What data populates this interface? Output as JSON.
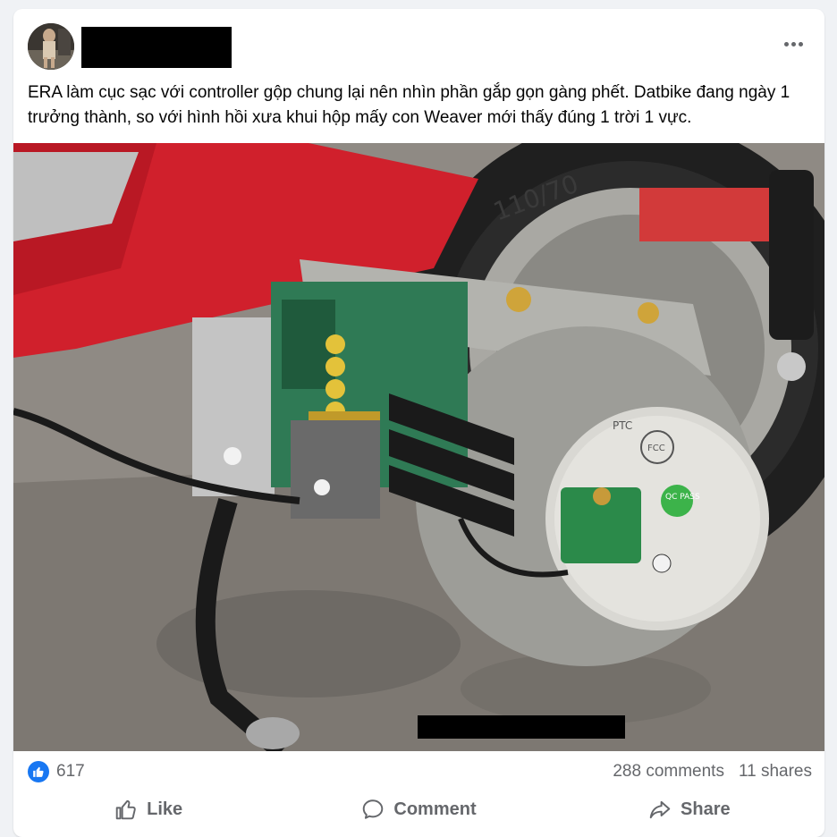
{
  "post": {
    "text": "ERA làm cục sạc với controller gộp chung lại nên nhìn phần gắp gọn gàng phết. Datbike đang ngày 1 trưởng thành, so với hình hồi xưa khui hộp mấy con Weaver mới thấy đúng 1 trời 1 vực.",
    "photo_labels": {
      "tire_marking": "110/70",
      "motor_badge_1": "FCC",
      "motor_badge_2": "QC PASS",
      "motor_brand": "PTC"
    }
  },
  "stats": {
    "reactions_count": "617",
    "comments": "288 comments",
    "shares": "11 shares"
  },
  "actions": {
    "like": "Like",
    "comment": "Comment",
    "share": "Share"
  },
  "icons": {
    "more": "more-horizontal-icon",
    "reaction": "thumbs-up-icon",
    "like": "thumbs-up-outline-icon",
    "comment": "comment-bubble-icon",
    "share": "share-arrow-icon"
  },
  "colors": {
    "accent": "#1877f2",
    "secondary_text": "#65676b",
    "body_text": "#050505",
    "qc_green": "#3cb34a"
  }
}
